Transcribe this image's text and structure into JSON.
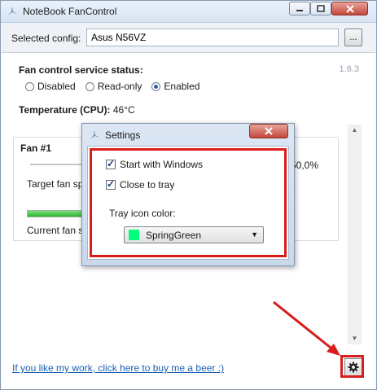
{
  "window": {
    "title": "NoteBook FanControl"
  },
  "config": {
    "label": "Selected config:",
    "value": "Asus N56VZ",
    "browse_label": "..."
  },
  "version": "1.6.3",
  "service": {
    "label": "Fan control service status:",
    "options": [
      {
        "label": "Disabled",
        "selected": false
      },
      {
        "label": "Read-only",
        "selected": false
      },
      {
        "label": "Enabled",
        "selected": true
      }
    ]
  },
  "temperature": {
    "label": "Temperature (CPU):",
    "value": "46°C"
  },
  "fan": {
    "title": "Fan #1",
    "target_label": "Target fan sp",
    "target_percent": "50,0%",
    "current_label": "Current fan s"
  },
  "footer": {
    "link_text": "If you like my work, click here to buy me a beer :)"
  },
  "settings": {
    "title": "Settings",
    "start_with_windows": "Start with Windows",
    "close_to_tray": "Close to tray",
    "tray_icon_color_label": "Tray icon color:",
    "tray_icon_color_value": "SpringGreen",
    "tray_icon_color_hex": "#00FF7F"
  },
  "colors": {
    "highlight": "#d91c1c",
    "link": "#1a5fb4"
  },
  "icons": [
    "app-icon",
    "minimize-icon",
    "maximize-icon",
    "close-icon",
    "gear-icon",
    "chevron-down-icon"
  ]
}
